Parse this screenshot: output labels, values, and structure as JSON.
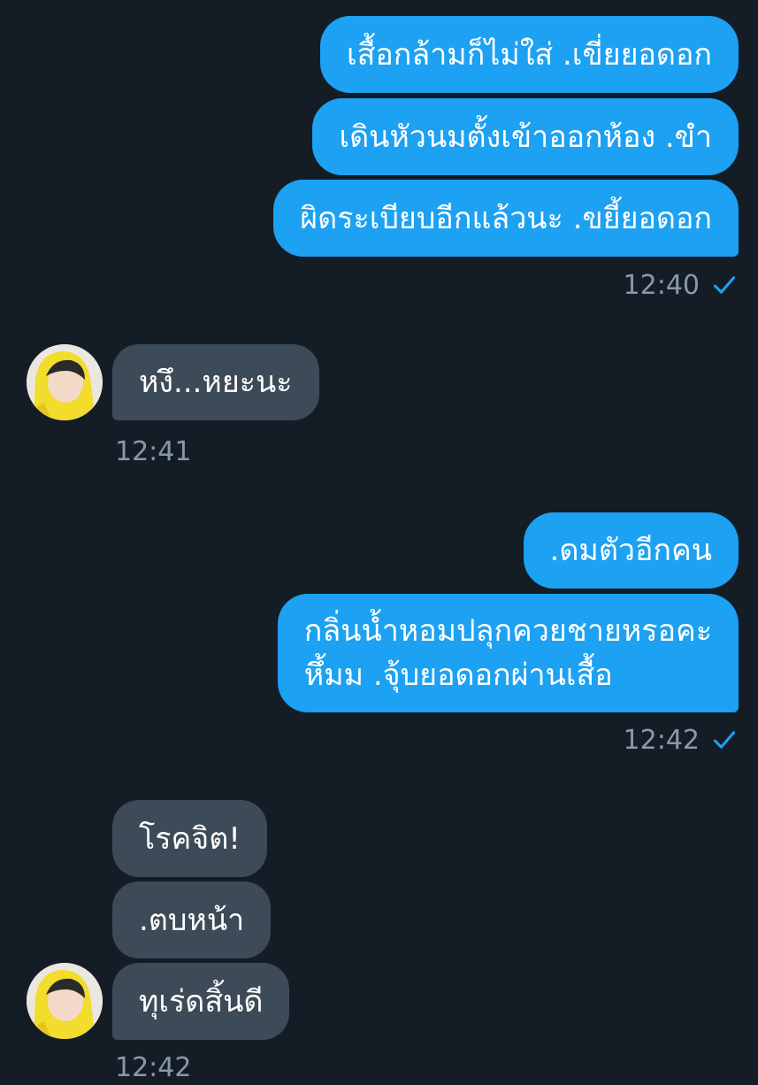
{
  "conversation": {
    "group1": {
      "messages": [
        "เสื้อกล้ามก็ไม่ใส่ .เขี่ยยอดอก",
        "เดินหัวนมตั้งเข้าออกห้อง .ขำ",
        "ผิดระเบียบอีกแล้วนะ .ขยี้ยอดอก"
      ],
      "time": "12:40"
    },
    "group2": {
      "messages": [
        "หงึ...หยะนะ"
      ],
      "time": "12:41"
    },
    "group3": {
      "messages": [
        ".ดมตัวอีกคน",
        "กลิ่นน้ำหอมปลุกควยชายหรอคะ\nหึ้มม .จุ้บยอดอกผ่านเสื้อ"
      ],
      "time": "12:42"
    },
    "group4": {
      "messages": [
        "โรคจิต!",
        ".ตบหน้า",
        "ทุเร่ดสิ้นดี"
      ],
      "time": "12:42"
    }
  },
  "colors": {
    "background": "#141d26",
    "sent_bubble": "#1da1f2",
    "received_bubble": "#3d4a57",
    "timestamp": "#8899a6",
    "check": "#1da1f2"
  },
  "icons": {
    "read_receipt": "check-icon",
    "avatar": "user-avatar"
  }
}
